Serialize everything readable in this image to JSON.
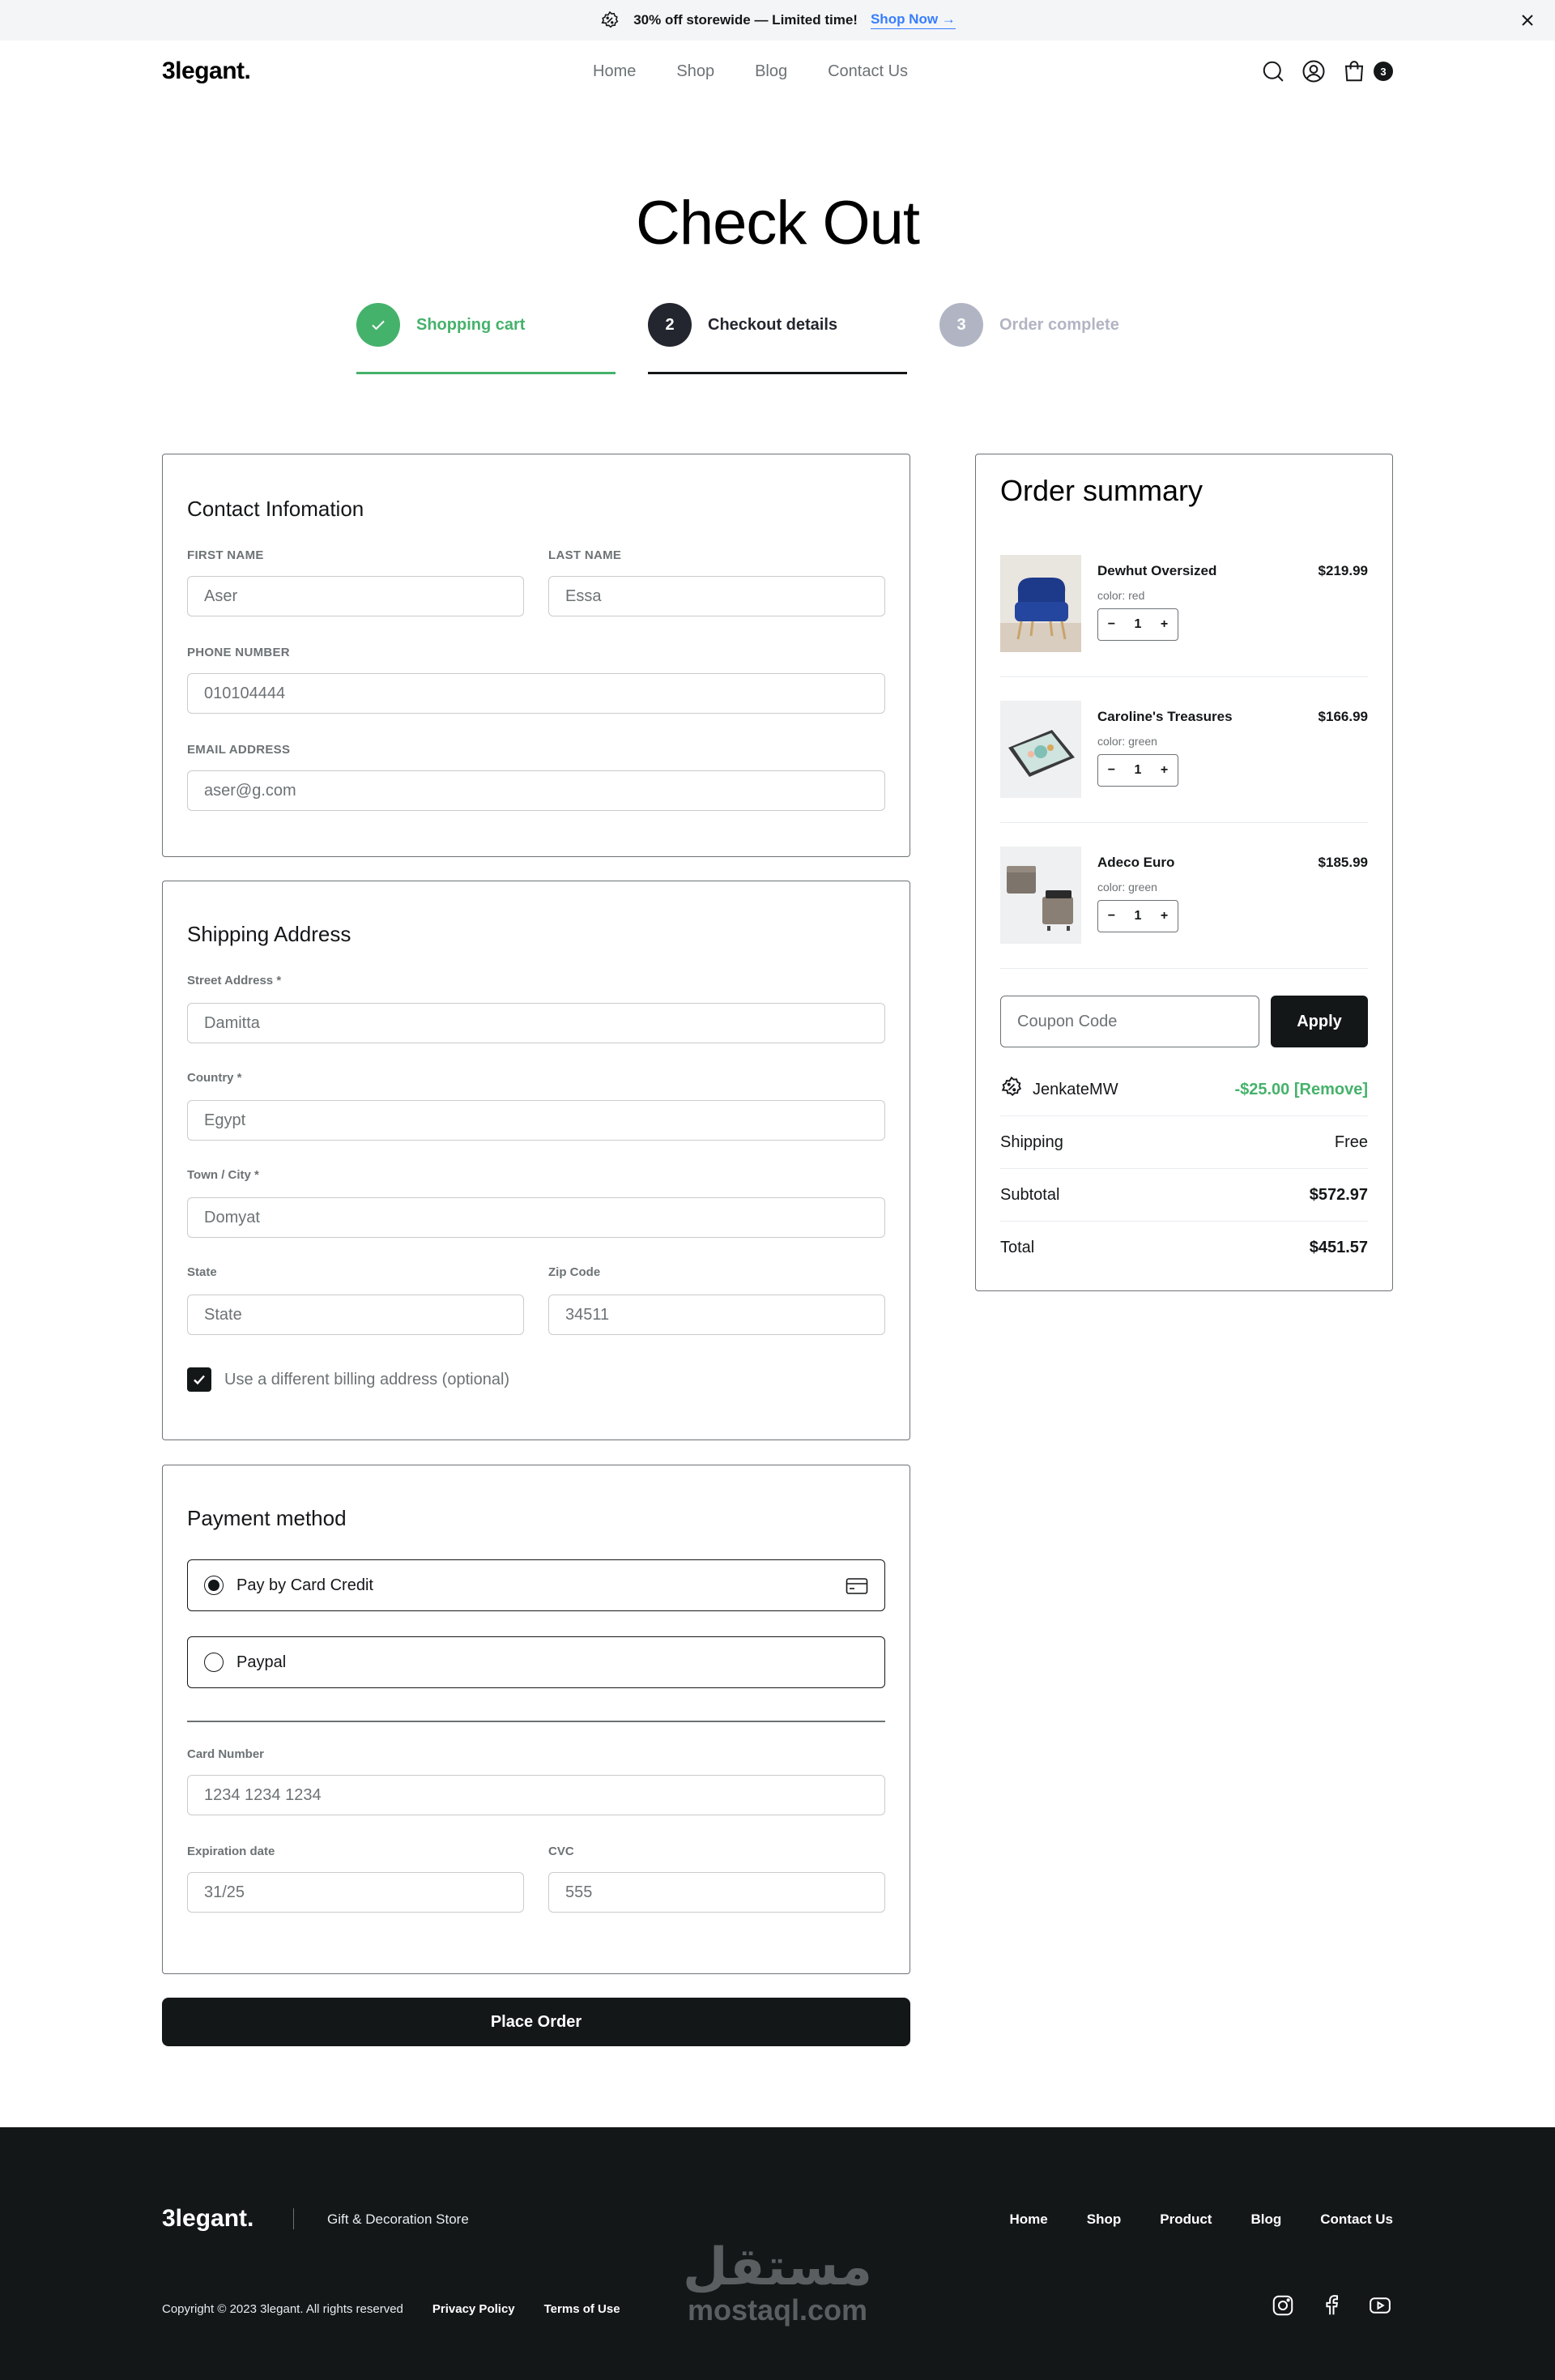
{
  "topbar": {
    "promo_text": "30% off storewide — Limited time!",
    "link_text": "Shop Now →",
    "link_color": "#377dff"
  },
  "nav": {
    "logo": "3legant.",
    "links": [
      "Home",
      "Shop",
      "Blog",
      "Contact Us"
    ],
    "cart_count": "3",
    "icons": [
      "search-icon",
      "user-icon",
      "shopping-bag-icon"
    ]
  },
  "page": {
    "title": "Check Out"
  },
  "steps": [
    {
      "number": "",
      "label": "Shopping cart",
      "state": "completed"
    },
    {
      "number": "2",
      "label": "Checkout details",
      "state": "active"
    },
    {
      "number": "3",
      "label": "Order complete",
      "state": "upcoming"
    }
  ],
  "contact": {
    "title": "Contact Infomation",
    "first_name_label": "FIRST NAME",
    "first_name_value": "Aser",
    "last_name_label": "LAST NAME",
    "last_name_value": "Essa",
    "phone_label": "PHONE NUMBER",
    "phone_value": "010104444",
    "email_label": "EMAIL ADDRESS",
    "email_value": "aser@g.com"
  },
  "shipping": {
    "title": "Shipping Address",
    "street_label": "Street Address *",
    "street_value": "Damitta",
    "country_label": "Country *",
    "country_value": "Egypt",
    "city_label": "Town / City *",
    "city_value": "Domyat",
    "state_label": "State",
    "state_placeholder": "State",
    "zip_label": "Zip Code",
    "zip_value": "34511",
    "billing_checkbox_label": "Use a different billing address (optional)",
    "billing_checked": true
  },
  "payment": {
    "title": "Payment method",
    "options": [
      {
        "label": "Pay by Card Credit",
        "selected": true
      },
      {
        "label": "Paypal",
        "selected": false
      }
    ],
    "card_number_label": "Card Number",
    "card_number_value": "1234 1234 1234",
    "expiry_label": "Expiration date",
    "expiry_value": "31/25",
    "cvc_label": "CVC",
    "cvc_value": "555"
  },
  "place_order_label": "Place Order",
  "summary": {
    "title": "Order summary",
    "items": [
      {
        "name": "Dewhut Oversized",
        "color": "color: red",
        "price": "$219.99",
        "qty": "1"
      },
      {
        "name": "Caroline's Treasures",
        "color": "color: green",
        "price": "$166.99",
        "qty": "1"
      },
      {
        "name": "Adeco Euro",
        "color": "color: green",
        "price": "$185.99",
        "qty": "1"
      }
    ],
    "coupon_placeholder": "Coupon Code",
    "apply_label": "Apply",
    "discount_code": "JenkateMW",
    "discount_value": "-$25.00 [Remove]",
    "shipping_label": "Shipping",
    "shipping_value": "Free",
    "subtotal_label": "Subtotal",
    "subtotal_value": "$572.97",
    "total_label": "Total",
    "total_value": "$451.57",
    "discount_color": "#45b26b"
  },
  "footer": {
    "logo": "3legant.",
    "tagline": "Gift & Decoration Store",
    "links": [
      "Home",
      "Shop",
      "Product",
      "Blog",
      "Contact Us"
    ],
    "copyright": "Copyright © 2023 3legant. All rights reserved",
    "privacy": "Privacy Policy",
    "terms": "Terms of Use",
    "social": [
      "instagram-icon",
      "facebook-icon",
      "youtube-icon"
    ],
    "watermark_ar": "مستقل",
    "watermark_en": "mostaql.com"
  }
}
